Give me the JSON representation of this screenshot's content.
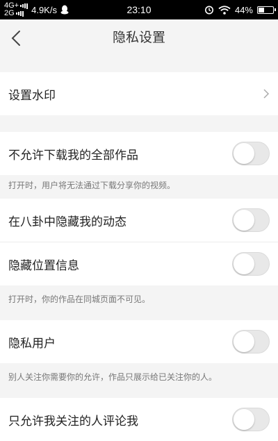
{
  "status_bar": {
    "network_top": "4G+",
    "network_bottom": "2G",
    "speed": "4.9K/s",
    "time": "23:10",
    "battery": "44%",
    "battery_level": 0.44,
    "icons": [
      "signal-icon",
      "qq-icon",
      "alarm-icon",
      "wifi-icon",
      "battery-icon"
    ]
  },
  "nav": {
    "title": "隐私设置",
    "back_icon": "back-chevron-icon"
  },
  "settings": {
    "watermark": {
      "label": "设置水印",
      "icon": "chevron-right-icon"
    },
    "no_download": {
      "label": "不允许下载我的全部作品",
      "on": false
    },
    "no_download_hint": "打开时，用户将无法通过下载分享你的视频。",
    "hide_in_gossip": {
      "label": "在八卦中隐藏我的动态",
      "on": false
    },
    "hide_location": {
      "label": "隐藏位置信息",
      "on": false
    },
    "hide_location_hint": "打开时，你的作品在同城页面不可见。",
    "private_user": {
      "label": "隐私用户",
      "on": false
    },
    "private_user_hint": "别人关注你需要你的允许，作品只展示给已关注你的人。",
    "comment_following_only": {
      "label": "只允许我关注的人评论我",
      "on": false
    }
  }
}
